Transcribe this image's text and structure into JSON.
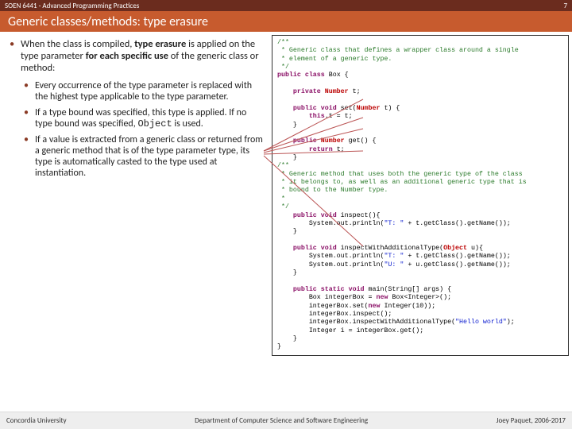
{
  "header": {
    "course": "SOEN 6441 - Advanced Programming Practices",
    "page_no": "7"
  },
  "title": "Generic classes/methods: type erasure",
  "bullets": {
    "main_pre": "When the class is compiled, ",
    "main_b1": "type erasure",
    "main_mid": " is applied on the type parameter ",
    "main_b2": "for each specific use",
    "main_post": " of the generic class or method:",
    "sub1": "Every occurrence of the type parameter is replaced with the highest type applicable to the type parameter.",
    "sub2_pre": "If a type bound was specified, this type is applied. If no type bound was specified, ",
    "sub2_code": "Object",
    "sub2_post": " is used.",
    "sub3": "If a value is extracted from a generic class or returned from a generic method that is of the type parameter type, its type is automatically casted to the type used at instantiation."
  },
  "code": {
    "c01": "/**",
    "c02": " * Generic class that defines a wrapper class around a single",
    "c03": " * element of a generic type.",
    "c04": " */",
    "c05a": "public class ",
    "c05b": "Box {",
    "c06a": "    private ",
    "c06b": "Number ",
    "c06c": "t;",
    "c07a": "    public void ",
    "c07b": "set(",
    "c07c": "Number ",
    "c07d": "t) {",
    "c08a": "        this",
    "c08b": ".t = t;",
    "c09": "    }",
    "c10a": "    public ",
    "c10b": "Number ",
    "c10c": "get() {",
    "c11a": "        return ",
    "c11b": "t;",
    "c12": "    }",
    "c13": "/**",
    "c14": " * Generic method that uses both the generic type of the class",
    "c15": " * it belongs to, as well as an additional generic type that is",
    "c16": " * bound to the Number type.",
    "c17": " *",
    "c18": " */",
    "c19a": "    public void ",
    "c19b": "inspect(){",
    "c20a": "        System.out.println(",
    "c20b": "\"T: \"",
    "c20c": " + t.getClass().getName());",
    "c21": "    }",
    "c22a": "    public void ",
    "c22b": "inspectWithAdditionalType(",
    "c22c": "Object ",
    "c22d": "u){",
    "c23a": "        System.out.println(",
    "c23b": "\"T: \"",
    "c23c": " + t.getClass().getName());",
    "c24a": "        System.out.println(",
    "c24b": "\"U: \"",
    "c24c": " + u.getClass().getName());",
    "c25": "    }",
    "c26a": "    public static void ",
    "c26b": "main(String[] args) {",
    "c27a": "        Box integerBox = ",
    "c27b": "new ",
    "c27c": "Box<Integer>();",
    "c28a": "        integerBox.set(",
    "c28b": "new ",
    "c28c": "Integer(10));",
    "c29": "        integerBox.inspect();",
    "c30a": "        integerBox.inspectWithAdditionalType(",
    "c30b": "\"Hello world\"",
    "c30c": ");",
    "c31": "        Integer i = integerBox.get();",
    "c32": "    }",
    "c33": "}"
  },
  "footer": {
    "left": "Concordia University",
    "center": "Department of Computer Science and Software Engineering",
    "right": "Joey Paquet, 2006-2017"
  },
  "colors": {
    "header_bg": "#6b2c1e",
    "title_bg": "#c75b2e"
  }
}
